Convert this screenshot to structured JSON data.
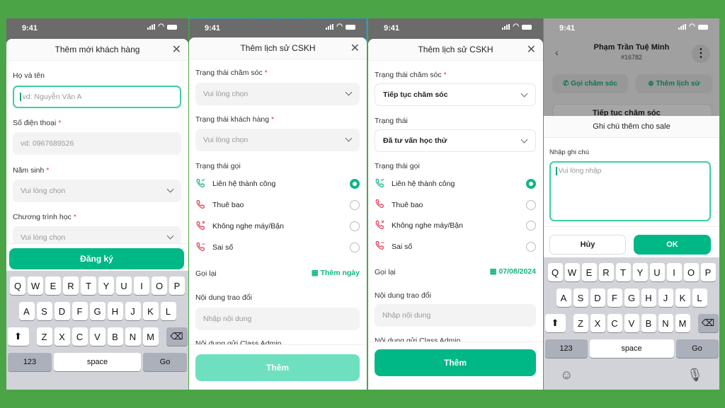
{
  "status_time": "9:41",
  "colors": {
    "primary": "#00b886",
    "primary_disabled": "#6ee0c0",
    "background": "#4ba446",
    "required": "#e53935"
  },
  "keyboard": {
    "rows": [
      [
        "Q",
        "W",
        "E",
        "R",
        "T",
        "Y",
        "U",
        "I",
        "O",
        "P"
      ],
      [
        "A",
        "S",
        "D",
        "F",
        "G",
        "H",
        "J",
        "K",
        "L"
      ],
      [
        "Z",
        "X",
        "C",
        "V",
        "B",
        "N",
        "M"
      ]
    ],
    "numbers_key": "123",
    "space_key": "space",
    "go_key": "Go",
    "shift_icon": "shift-icon",
    "backspace_icon": "backspace-icon"
  },
  "screen1": {
    "title": "Thêm mới khách hàng",
    "fields": [
      {
        "label": "Họ và tên",
        "required": false,
        "placeholder": "vd: Nguyễn Văn A"
      },
      {
        "label": "Số điện thoại",
        "required": true,
        "placeholder": "vd: 0967689526"
      },
      {
        "label": "Năm sinh",
        "required": true,
        "placeholder": "Vui lòng chọn"
      },
      {
        "label": "Chương trình học",
        "required": true,
        "placeholder": "Vui lòng chọn"
      }
    ],
    "submit": "Đăng ký"
  },
  "screen2": {
    "title": "Thêm lịch sử CSKH",
    "care_status": {
      "label": "Trạng thái chăm sóc",
      "value": "Vui lòng chọn"
    },
    "customer_status": {
      "label": "Trạng thái khách hàng",
      "value": "Vui lòng chọn"
    },
    "call_status_label": "Trạng thái gọi",
    "call_options": [
      {
        "label": "Liên hệ thành công",
        "icon": "phone-success-icon",
        "selected": true
      },
      {
        "label": "Thuê bao",
        "icon": "phone-hangup-icon",
        "selected": false
      },
      {
        "label": "Không nghe máy/Bận",
        "icon": "phone-missed-icon",
        "selected": false
      },
      {
        "label": "Sai số",
        "icon": "phone-wrong-icon",
        "selected": false
      }
    ],
    "callback_label": "Gọi lại",
    "callback_value": "Thêm ngày",
    "exchange_label": "Nội dung trao đổi",
    "exchange_placeholder": "Nhập nội dung",
    "admin_label": "Nội dung gửi Class Admin",
    "submit": "Thêm"
  },
  "screen3": {
    "title": "Thêm lịch sử CSKH",
    "care_status": {
      "label": "Trạng thái chăm sóc",
      "value": "Tiếp tục chăm sóc"
    },
    "customer_status": {
      "label": "Trạng thái",
      "value": "Đã tư vấn học thử"
    },
    "call_status_label": "Trạng thái gọi",
    "call_options": [
      {
        "label": "Liên hệ thành công",
        "selected": true
      },
      {
        "label": "Thuê bao",
        "selected": false
      },
      {
        "label": "Không nghe máy/Bận",
        "selected": false
      },
      {
        "label": "Sai số",
        "selected": false
      }
    ],
    "callback_label": "Gọi lại",
    "callback_value": "07/08/2024",
    "exchange_label": "Nội dung trao đổi",
    "exchange_placeholder": "Nhập nội dung",
    "admin_label": "Nội dung gửi Class Admin",
    "submit": "Thêm"
  },
  "screen4": {
    "name": "Phạm Trần Tuệ Minh",
    "id": "#16782",
    "call_button": "Gọi chăm sóc",
    "add_history_button": "Thêm lịch sử",
    "card_title": "Tiếp tục chăm sóc",
    "modal_title": "Ghi chú thêm cho sale",
    "note_label": "Nhập ghi chú",
    "note_placeholder": "Vui lòng nhập",
    "cancel": "Hủy",
    "ok": "OK"
  }
}
